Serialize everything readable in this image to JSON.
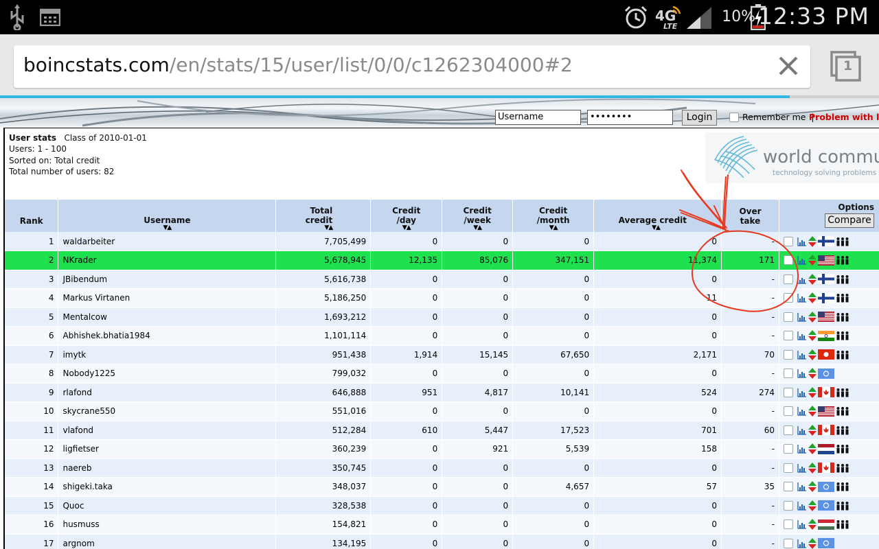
{
  "status_bar": {
    "battery_pct": "10%",
    "time": "12:33 PM",
    "network": "4G LTE"
  },
  "browser": {
    "url_domain": "boincstats.com",
    "url_path": "/en/stats/15/user/list/0/0/c1262304000#2",
    "tab_count": "1"
  },
  "login": {
    "username_value": "Username",
    "password_value": "••••••••",
    "login_label": "Login",
    "remember_label": "Remember me",
    "separator": "|",
    "problem_label": "Problem with login"
  },
  "info": {
    "title": "User stats",
    "class_label": "Class of 2010-01-01",
    "users_line": "Users: 1 - 100",
    "sorted_line": "Sorted on: Total credit",
    "total_line": "Total number of users: 82"
  },
  "logo": {
    "name": "world community",
    "tagline": "technology solving problems"
  },
  "table": {
    "headers": {
      "rank": "Rank",
      "username": "Username",
      "total_credit_1": "Total",
      "total_credit_2": "credit",
      "credit_day_1": "Credit",
      "credit_day_2": "/day",
      "credit_week_1": "Credit",
      "credit_week_2": "/week",
      "credit_month_1": "Credit",
      "credit_month_2": "/month",
      "avg_credit": "Average credit",
      "overtake_1": "Over",
      "overtake_2": "take",
      "options": "Options",
      "compare": "Compare"
    },
    "rows": [
      {
        "rank": "1",
        "user": "waldarbeiter",
        "total": "7,705,499",
        "day": "0",
        "week": "0",
        "month": "0",
        "avg": "0",
        "over": "-",
        "flag": "fi",
        "people": true
      },
      {
        "rank": "2",
        "user": "NKrader",
        "total": "5,678,945",
        "day": "12,135",
        "week": "85,076",
        "month": "347,151",
        "avg": "11,374",
        "over": "171",
        "flag": "us",
        "people": true,
        "highlight": true
      },
      {
        "rank": "3",
        "user": "JBibendum",
        "total": "5,616,738",
        "day": "0",
        "week": "0",
        "month": "0",
        "avg": "0",
        "over": "-",
        "flag": "fi",
        "people": true
      },
      {
        "rank": "4",
        "user": "Markus Virtanen",
        "total": "5,186,250",
        "day": "0",
        "week": "0",
        "month": "0",
        "avg": "11",
        "over": "-",
        "flag": "fi",
        "people": true
      },
      {
        "rank": "5",
        "user": "Mentalcow",
        "total": "1,693,212",
        "day": "0",
        "week": "0",
        "month": "0",
        "avg": "0",
        "over": "-",
        "flag": "us",
        "people": true
      },
      {
        "rank": "6",
        "user": "Abhishek.bhatia1984",
        "total": "1,101,114",
        "day": "0",
        "week": "0",
        "month": "0",
        "avg": "0",
        "over": "-",
        "flag": "in",
        "people": true
      },
      {
        "rank": "7",
        "user": "imytk",
        "total": "951,438",
        "day": "1,914",
        "week": "15,145",
        "month": "67,650",
        "avg": "2,171",
        "over": "70",
        "flag": "hk",
        "people": true
      },
      {
        "rank": "8",
        "user": "Nobody1225",
        "total": "799,032",
        "day": "0",
        "week": "0",
        "month": "0",
        "avg": "0",
        "over": "-",
        "flag": "un",
        "people": false
      },
      {
        "rank": "9",
        "user": "rlafond",
        "total": "646,888",
        "day": "951",
        "week": "4,817",
        "month": "10,141",
        "avg": "524",
        "over": "274",
        "flag": "ca",
        "people": true
      },
      {
        "rank": "10",
        "user": "skycrane550",
        "total": "551,016",
        "day": "0",
        "week": "0",
        "month": "0",
        "avg": "0",
        "over": "-",
        "flag": "us",
        "people": true
      },
      {
        "rank": "11",
        "user": "vlafond",
        "total": "512,284",
        "day": "610",
        "week": "5,447",
        "month": "17,523",
        "avg": "701",
        "over": "60",
        "flag": "ca",
        "people": true
      },
      {
        "rank": "12",
        "user": "ligfietser",
        "total": "360,239",
        "day": "0",
        "week": "921",
        "month": "5,539",
        "avg": "158",
        "over": "-",
        "flag": "nl",
        "people": true
      },
      {
        "rank": "13",
        "user": "naereb",
        "total": "350,745",
        "day": "0",
        "week": "0",
        "month": "0",
        "avg": "0",
        "over": "-",
        "flag": "ca",
        "people": true
      },
      {
        "rank": "14",
        "user": "shigeki.taka",
        "total": "348,037",
        "day": "0",
        "week": "0",
        "month": "4,657",
        "avg": "57",
        "over": "35",
        "flag": "un",
        "people": true
      },
      {
        "rank": "15",
        "user": "Quoc",
        "total": "328,538",
        "day": "0",
        "week": "0",
        "month": "0",
        "avg": "0",
        "over": "-",
        "flag": "un",
        "people": true
      },
      {
        "rank": "16",
        "user": "husmuss",
        "total": "154,821",
        "day": "0",
        "week": "0",
        "month": "0",
        "avg": "0",
        "over": "-",
        "flag": "hu",
        "people": true
      },
      {
        "rank": "17",
        "user": "argnom",
        "total": "134,195",
        "day": "0",
        "week": "0",
        "month": "0",
        "avg": "0",
        "over": "-",
        "flag": "un",
        "people": false
      }
    ]
  },
  "colors": {
    "header_bg": "#c5d7ee",
    "row_odd": "#e7effa",
    "row_even": "#f5f8fc",
    "highlight_row": "#1fe04f",
    "annotation_red": "#e8391e",
    "problem_link": "#d40000"
  }
}
